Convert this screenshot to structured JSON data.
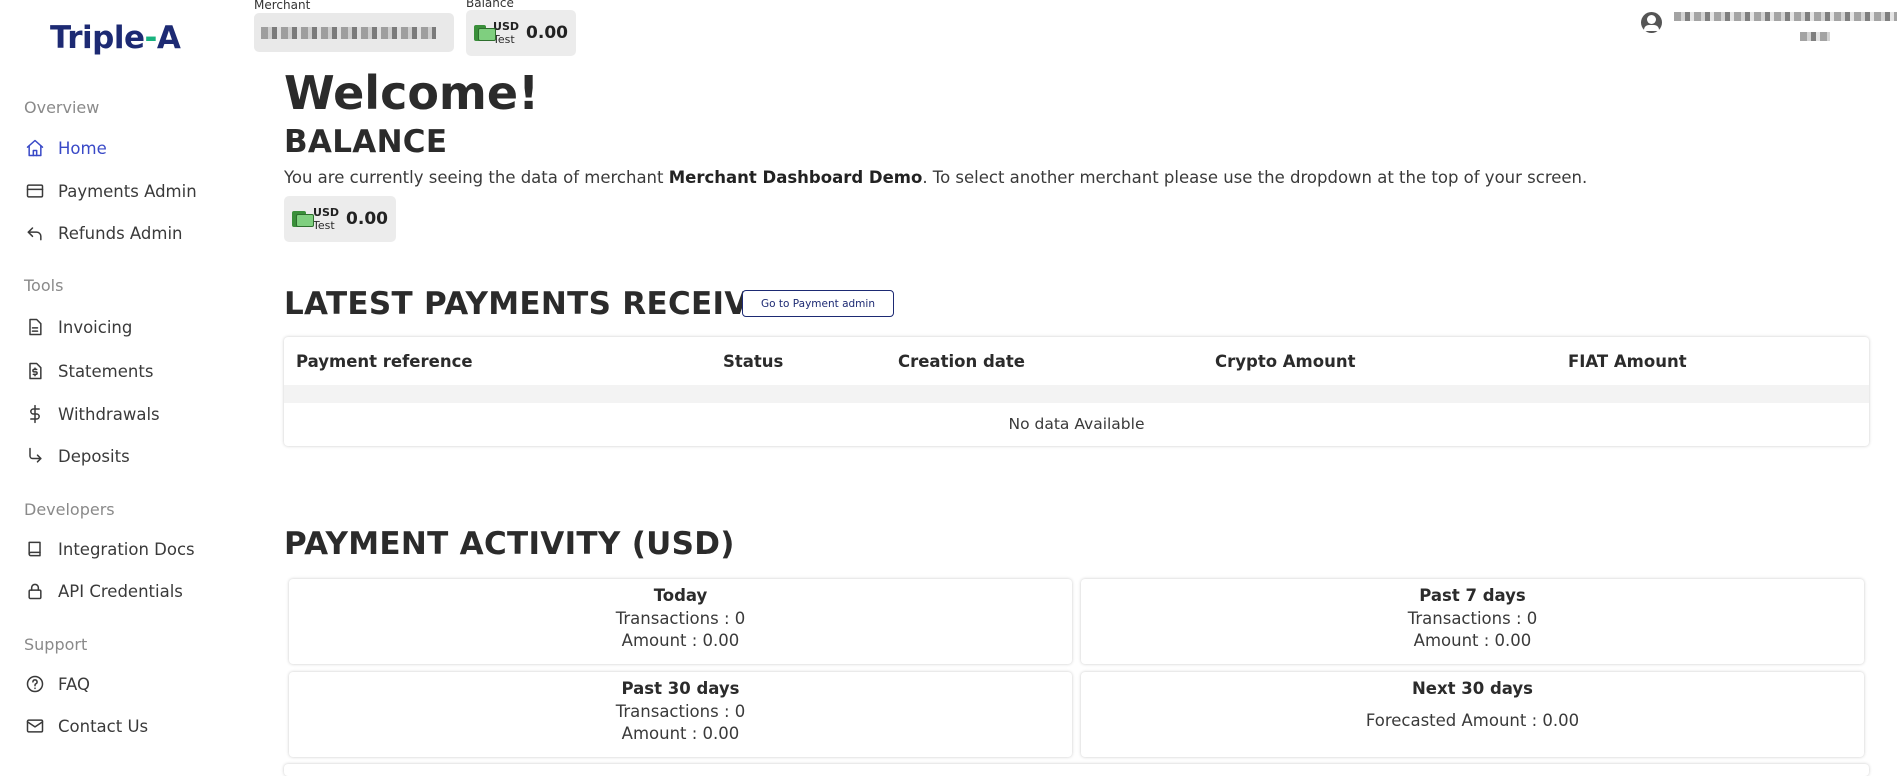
{
  "brand": {
    "name_a": "Triple",
    "name_dot": "-",
    "name_b": "A"
  },
  "sidebar": {
    "sections": [
      {
        "label": "Overview"
      },
      {
        "label": "Tools"
      },
      {
        "label": "Developers"
      },
      {
        "label": "Support"
      }
    ],
    "items": [
      {
        "label": "Home",
        "icon": "home-icon",
        "active": true
      },
      {
        "label": "Payments Admin",
        "icon": "credit-card-icon"
      },
      {
        "label": "Refunds Admin",
        "icon": "reply-arrow-icon"
      },
      {
        "label": "Invoicing",
        "icon": "document-icon"
      },
      {
        "label": "Statements",
        "icon": "dollar-document-icon"
      },
      {
        "label": "Withdrawals",
        "icon": "dollar-icon"
      },
      {
        "label": "Deposits",
        "icon": "arrow-down-right-icon"
      },
      {
        "label": "Integration Docs",
        "icon": "book-icon"
      },
      {
        "label": "API Credentials",
        "icon": "lock-icon"
      },
      {
        "label": "FAQ",
        "icon": "help-circle-icon"
      },
      {
        "label": "Contact Us",
        "icon": "mail-icon"
      }
    ]
  },
  "topbar": {
    "merchant_label": "Merchant",
    "balance_label": "Balance",
    "balance": {
      "currency": "USD",
      "mode": "Test",
      "amount": "0.00"
    },
    "user_suffix": "g"
  },
  "main": {
    "welcome": "Welcome!",
    "balance_heading": "BALANCE",
    "info_prefix": "You are currently seeing the data of merchant ",
    "merchant_name": "Merchant Dashboard Demo",
    "info_suffix": ". To select another merchant please use the dropdown at the top of your screen.",
    "balance_card": {
      "currency": "USD",
      "mode": "Test",
      "amount": "0.00"
    },
    "latest_heading": "LATEST PAYMENTS RECEIVED",
    "go_button": "Go to Payment admin",
    "table": {
      "columns": [
        "Payment reference",
        "Status",
        "Creation date",
        "Crypto Amount",
        "FIAT Amount"
      ],
      "empty_text": "No data Available"
    },
    "activity_heading": "PAYMENT ACTIVITY (USD)",
    "activity": [
      {
        "title": "Today",
        "line1": "Transactions : 0",
        "line2": "Amount : 0.00"
      },
      {
        "title": "Past 7 days",
        "line1": "Transactions : 0",
        "line2": "Amount : 0.00"
      },
      {
        "title": "Past 30 days",
        "line1": "Transactions : 0",
        "line2": "Amount : 0.00"
      },
      {
        "title": "Next 30 days",
        "line1": "Forecasted Amount : 0.00"
      }
    ]
  },
  "colors": {
    "brand": "#1d2a73",
    "accent": "#18b37e",
    "active": "#3949c7"
  }
}
